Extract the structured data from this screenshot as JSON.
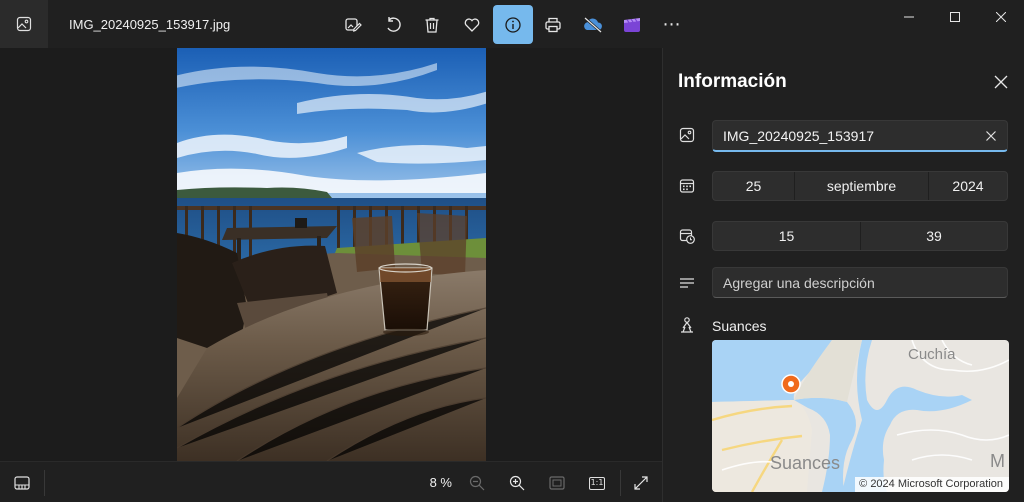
{
  "titlebar": {
    "file_name": "IMG_20240925_153917.jpg",
    "toolbar": [
      {
        "name": "edit-image",
        "icon": "edit-image-icon"
      },
      {
        "name": "rotate",
        "icon": "rotate-icon"
      },
      {
        "name": "delete",
        "icon": "trash-icon"
      },
      {
        "name": "favorite",
        "icon": "heart-icon"
      },
      {
        "name": "info",
        "icon": "info-icon",
        "active": true
      },
      {
        "name": "print",
        "icon": "printer-icon"
      },
      {
        "name": "onedrive",
        "icon": "cloud-off-icon"
      },
      {
        "name": "clipchamp",
        "icon": "clipchamp-icon"
      },
      {
        "name": "more",
        "icon": "more-icon",
        "glyph": "⋯"
      }
    ],
    "window_controls": [
      "minimize",
      "maximize",
      "close"
    ],
    "accent_color": "#76b9ed"
  },
  "bottombar": {
    "zoom_value": "8 %",
    "buttons": [
      "filmstrip",
      "zoom-out",
      "zoom-in",
      "fit-to-window",
      "actual-size",
      "fullscreen"
    ],
    "actual_size_label": "1:1"
  },
  "panel": {
    "title": "Información",
    "file_name_value": "IMG_20240925_153917",
    "date": {
      "day": "25",
      "month": "septiembre",
      "year": "2024"
    },
    "time": {
      "hour": "15",
      "minute": "39"
    },
    "description_placeholder": "Agregar una descripción",
    "location": "Suances",
    "map": {
      "labels": {
        "cuchia": "Cuchía",
        "suances": "Suances",
        "partial": "M"
      },
      "copyright": "© 2024 Microsoft Corporation",
      "pin_color": "#f06a1c"
    }
  }
}
